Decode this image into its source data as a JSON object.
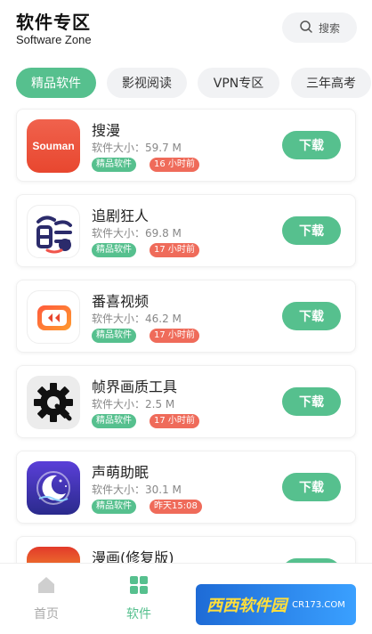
{
  "header": {
    "title": "软件专区",
    "subtitle": "Software Zone",
    "search_label": "搜索"
  },
  "tabs": [
    {
      "label": "精品软件",
      "active": true
    },
    {
      "label": "影视阅读",
      "active": false
    },
    {
      "label": "VPN专区",
      "active": false
    },
    {
      "label": "三年高考",
      "active": false
    }
  ],
  "apps": [
    {
      "name": "搜漫",
      "size": "软件大小：59.7 M",
      "category": "精品软件",
      "time": "16 小时前",
      "download_label": "下载",
      "icon_text": "Souman",
      "icon": "souman-icon"
    },
    {
      "name": "追剧狂人",
      "size": "软件大小：69.8 M",
      "category": "精品软件",
      "time": "17 小时前",
      "download_label": "下载",
      "icon": "drama-fan-icon"
    },
    {
      "name": "番喜视频",
      "size": "软件大小：46.2 M",
      "category": "精品软件",
      "time": "17 小时前",
      "download_label": "下载",
      "icon": "fanxi-video-icon"
    },
    {
      "name": "帧界画质工具",
      "size": "软件大小：2.5 M",
      "category": "精品软件",
      "time": "17 小时前",
      "download_label": "下载",
      "icon": "gear-icon"
    },
    {
      "name": "声萌助眠",
      "size": "软件大小：30.1 M",
      "category": "精品软件",
      "time": "昨天15:08",
      "download_label": "下载",
      "icon": "moon-sleep-icon"
    },
    {
      "name": "漫画(修复版)",
      "size": "",
      "category": "",
      "time": "",
      "download_label": "下载",
      "icon": "manga-icon"
    }
  ],
  "bottom_nav": [
    {
      "label": "首页",
      "icon": "home-icon",
      "active": false
    },
    {
      "label": "软件",
      "icon": "apps-grid-icon",
      "active": true
    }
  ],
  "watermark": {
    "main": "西西软件园",
    "sub": "CR173.COM"
  },
  "colors": {
    "accent": "#56c08e",
    "time_tag": "#ef6b5a",
    "tab_inactive": "#f1f2f4"
  }
}
